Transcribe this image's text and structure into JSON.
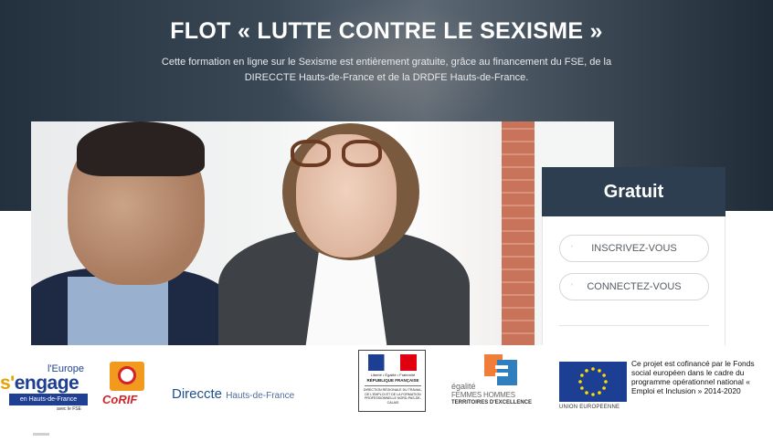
{
  "hero": {
    "title": "FLOT « LUTTE CONTRE LE SEXISME »",
    "subtitle_line1": "Cette formation en ligne sur le Sexisme est entièrement gratuite, grâce au financement du FSE, de la",
    "subtitle_line2": "DIRECCTE Hauts-de-France et de la DRDFE Hauts-de-France."
  },
  "panel": {
    "title": "Gratuit",
    "register_label": "INSCRIVEZ-VOUS",
    "login_label": "CONNECTEZ-VOUS",
    "tick": "'"
  },
  "logos": {
    "europe": {
      "top": "l'Europe",
      "main_a": "s'",
      "main_b": "engage",
      "band": "en Hauts-de-France",
      "note": "avec le FSE"
    },
    "corif": {
      "name": "CoRIF"
    },
    "direccte": {
      "name": "Direccte",
      "region": "Hauts-de-France"
    },
    "republique": {
      "motto": "Liberté • Égalité • Fraternité",
      "country": "RÉPUBLIQUE FRANÇAISE",
      "body": "DIRECTION RÉGIONALE DU TRAVAIL, DE L'EMPLOI ET DE LA FORMATION PROFESSIONNELLE NORD-PAS-DE-CALAIS"
    },
    "egalite": {
      "line1": "égalité",
      "line2": "FEMMES HOMMES",
      "line3": "TERRITOIRES D'EXCELLENCE"
    },
    "ue": {
      "label": "UNION EUROPEENNE",
      "text": "Ce projet est cofinancé par le Fonds social européen dans le cadre du programme opérationnel national « Emploi et Inclusion » 2014-2020"
    }
  },
  "colors": {
    "panel_header": "#2c3e50",
    "europe_blue": "#1f3f93",
    "corif_orange": "#f19a1d",
    "corif_red": "#d2232a"
  }
}
